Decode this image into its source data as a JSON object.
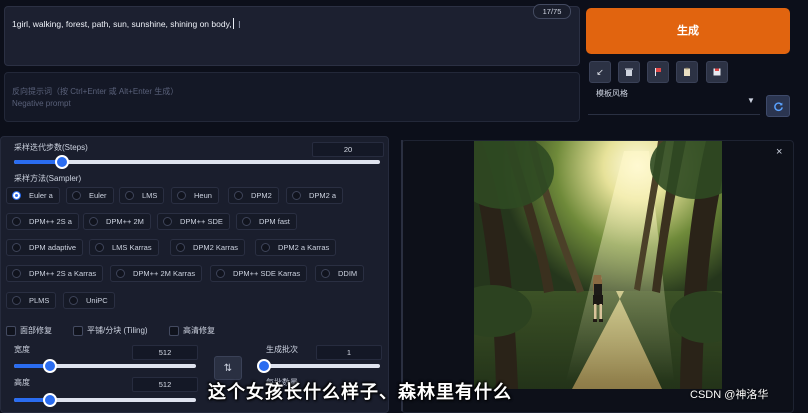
{
  "prompt": {
    "text": "1girl, walking, forest, path, sun, sunshine, shining on body,",
    "token_count": "17/75"
  },
  "negative_prompt": {
    "placeholder_line1": "反向提示词（按 Ctrl+Enter 或 Alt+Enter 生成）",
    "placeholder_line2": "Negative prompt"
  },
  "generate_label": "生成",
  "tools": [
    {
      "icon": "arrow-icon",
      "glyph": "↙",
      "color": "#e6e9f0"
    },
    {
      "icon": "trash-icon",
      "glyph": "🗑",
      "color": "#cfd4df"
    },
    {
      "icon": "flag-icon",
      "glyph": "▚",
      "color": "#e05050"
    },
    {
      "icon": "clipboard-icon",
      "glyph": "▤",
      "color": "#e6dcc0"
    },
    {
      "icon": "save-style-icon",
      "glyph": "▣",
      "color": "#e05050"
    }
  ],
  "styles": {
    "label": "模板风格",
    "selected": ""
  },
  "steps": {
    "label": "采样迭代步数(Steps)",
    "value": "20",
    "fraction": 0.13
  },
  "sampler": {
    "label": "采样方法(Sampler)",
    "selected": "Euler a",
    "rows": [
      [
        "Euler a",
        "Euler",
        "LMS",
        "Heun",
        "DPM2",
        "DPM2 a"
      ],
      [
        "DPM++ 2S a",
        "DPM++ 2M",
        "DPM++ SDE",
        "DPM fast"
      ],
      [
        "DPM adaptive",
        "LMS Karras",
        "DPM2 Karras",
        "DPM2 a Karras"
      ],
      [
        "DPM++ 2S a Karras",
        "DPM++ 2M Karras",
        "DPM++ SDE Karras",
        "DDIM"
      ],
      [
        "PLMS",
        "UniPC"
      ]
    ]
  },
  "checkboxes": {
    "restore_faces": "面部修复",
    "tiling": "平铺/分块 (Tiling)",
    "hires_fix": "高清修复"
  },
  "width": {
    "label": "宽度",
    "value": "512",
    "fraction": 0.2
  },
  "height": {
    "label": "高度",
    "value": "512",
    "fraction": 0.2
  },
  "batch_count": {
    "label": "生成批次",
    "value": "1",
    "fraction": 0.02
  },
  "batch_size": {
    "label": "每批数量"
  },
  "image_panel": {
    "close_glyph": "×"
  },
  "overlay": {
    "subtitle": "这个女孩长什么样子、森林里有什么",
    "watermark": "CSDN @神洛华"
  },
  "colors": {
    "accent": "#e1640f",
    "slider": "#2a6cf0"
  }
}
